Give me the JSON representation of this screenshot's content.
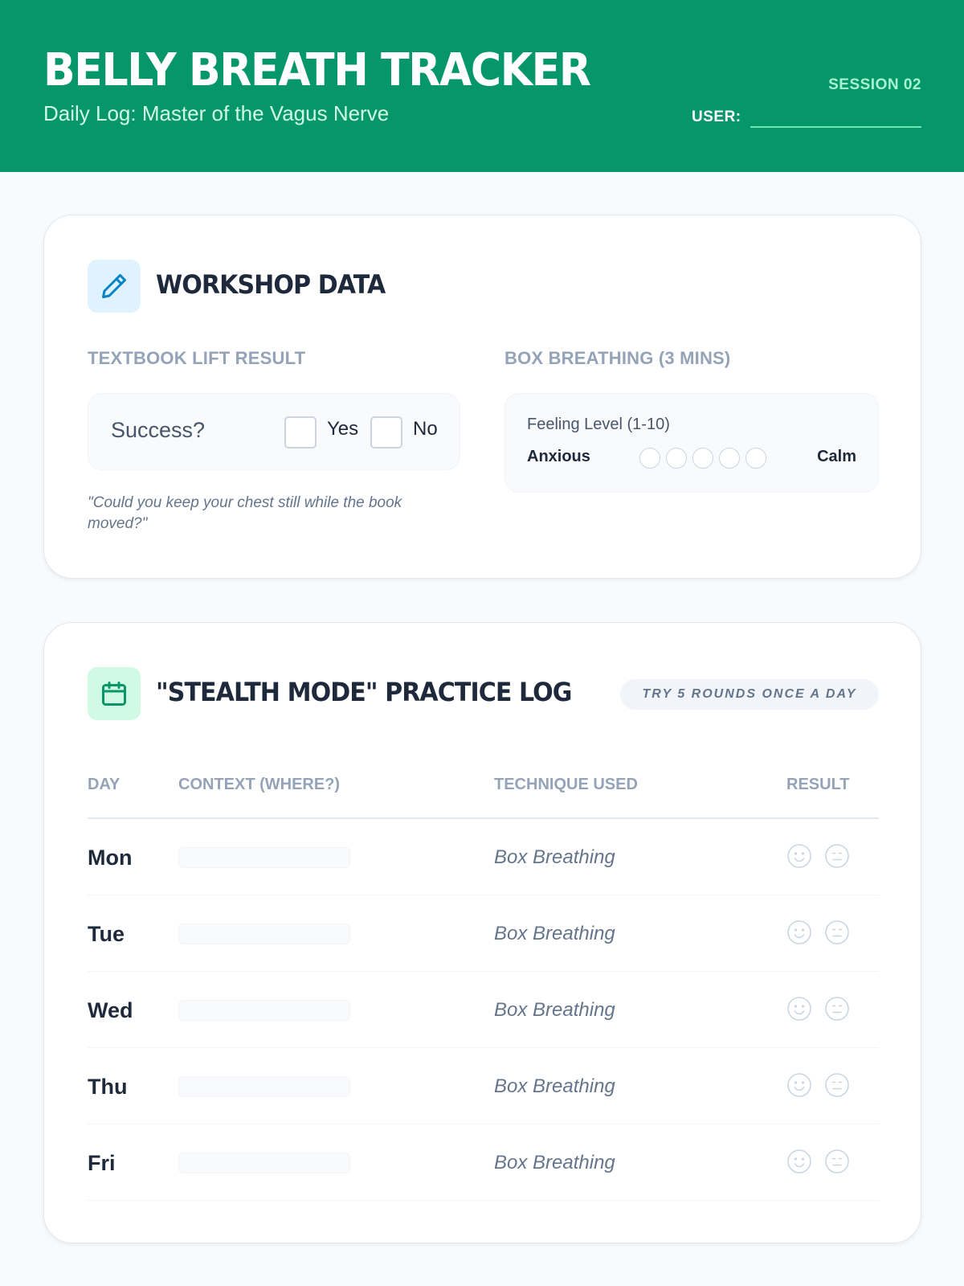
{
  "header": {
    "title": "BELLY BREATH TRACKER",
    "subtitle": "Daily Log: Master of the Vagus Nerve",
    "session": "SESSION 02",
    "user_label": "USER:",
    "user_value": ""
  },
  "workshop": {
    "icon": "pencil-icon",
    "title": "WORKSHOP DATA",
    "lift": {
      "label": "TEXTBOOK LIFT RESULT",
      "question": "Success?",
      "yes_label": "Yes",
      "no_label": "No",
      "yes_checked": false,
      "no_checked": false,
      "quote": "\"Could you keep your chest still while the book moved?\""
    },
    "box": {
      "label": "BOX BREATHING (3 MINS)",
      "feeling_label": "Feeling Level (1-10)",
      "low_label": "Anxious",
      "high_label": "Calm",
      "scale_dots": 5,
      "selected": null
    }
  },
  "practice": {
    "icon": "calendar-icon",
    "title": "\"STEALTH MODE\" PRACTICE LOG",
    "badge": "TRY 5 ROUNDS ONCE A DAY",
    "columns": [
      "DAY",
      "CONTEXT (WHERE?)",
      "TECHNIQUE USED",
      "RESULT"
    ],
    "rows": [
      {
        "day": "Mon",
        "context": "",
        "technique": "Box Breathing",
        "result_options": [
          "smile-face-icon",
          "neutral-face-icon"
        ]
      },
      {
        "day": "Tue",
        "context": "",
        "technique": "Box Breathing",
        "result_options": [
          "smile-face-icon",
          "neutral-face-icon"
        ]
      },
      {
        "day": "Wed",
        "context": "",
        "technique": "Box Breathing",
        "result_options": [
          "smile-face-icon",
          "neutral-face-icon"
        ]
      },
      {
        "day": "Thu",
        "context": "",
        "technique": "Box Breathing",
        "result_options": [
          "smile-face-icon",
          "neutral-face-icon"
        ]
      },
      {
        "day": "Fri",
        "context": "",
        "technique": "Box Breathing",
        "result_options": [
          "smile-face-icon",
          "neutral-face-icon"
        ]
      }
    ]
  },
  "colors": {
    "header_bg": "#05976a",
    "pencil_icon": "#0284c7",
    "calendar_icon": "#059669"
  }
}
